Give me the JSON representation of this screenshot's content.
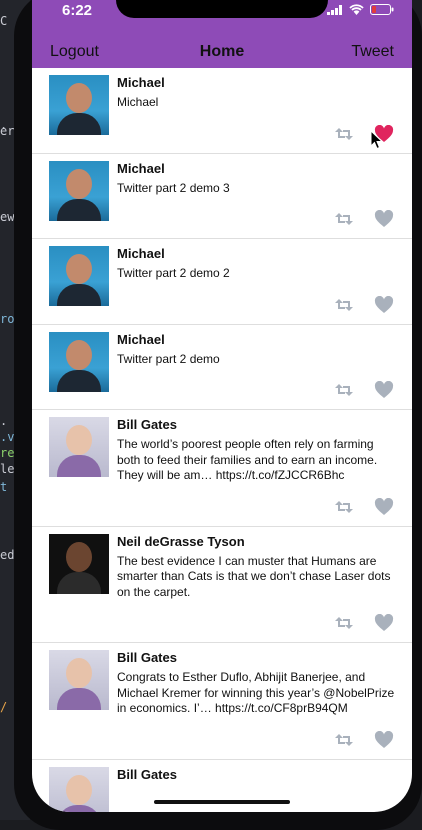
{
  "status_bar": {
    "time": "6:22"
  },
  "nav": {
    "left": "Logout",
    "title": "Home",
    "right": "Tweet"
  },
  "colors": {
    "accent": "#8e4bb7",
    "liked": "#e0245e",
    "icon_default": "#a9b1bc"
  },
  "tweets": [
    {
      "name": "Michael",
      "text": "Michael",
      "avatar": "michael",
      "liked": true
    },
    {
      "name": "Michael",
      "text": "Twitter part 2 demo 3",
      "avatar": "michael",
      "liked": false
    },
    {
      "name": "Michael",
      "text": "Twitter part 2 demo 2",
      "avatar": "michael",
      "liked": false
    },
    {
      "name": "Michael",
      "text": "Twitter part 2 demo",
      "avatar": "michael",
      "liked": false
    },
    {
      "name": "Bill Gates",
      "text": "The world’s poorest people often rely on farming both to feed their families and to earn an income. They will be am… https://t.co/fZJCCR6Bhc",
      "avatar": "gates",
      "liked": false
    },
    {
      "name": "Neil deGrasse Tyson",
      "text": "The best evidence I can muster that Humans are smarter than Cats is that we don’t chase Laser dots on the carpet.",
      "avatar": "tyson",
      "liked": false
    },
    {
      "name": "Bill Gates",
      "text": "Congrats to Esther Duflo, Abhijit Banerjee, and Michael Kremer for winning this year’s @NobelPrize in economics. I’… https://t.co/CF8prB94QM",
      "avatar": "gates",
      "liked": false
    },
    {
      "name": "Bill Gates",
      "text": "",
      "avatar": "gates",
      "liked": false
    }
  ]
}
